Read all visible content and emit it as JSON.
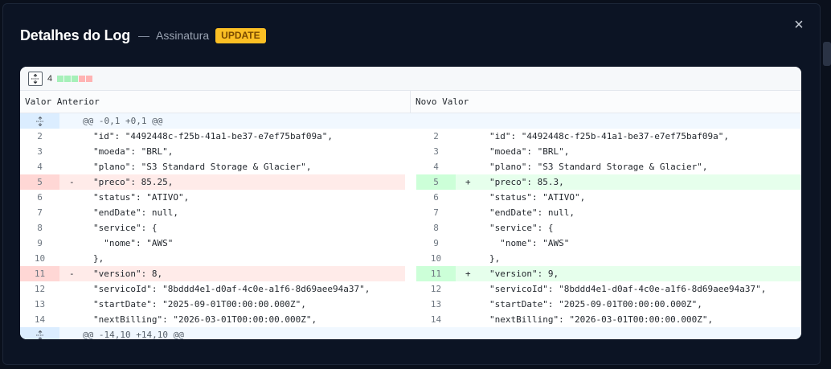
{
  "modal": {
    "title": "Detalhes do Log",
    "separator": "—",
    "subtitle": "Assinatura",
    "badge": "UPDATE",
    "close_icon": "×"
  },
  "toolbar": {
    "change_count": "4",
    "change_blocks": [
      "#a6f0b9",
      "#a6f0b9",
      "#a6f0b9",
      "#ffb3b3",
      "#ffb3b3"
    ]
  },
  "columns": {
    "left": "Valor Anterior",
    "right": "Novo Valor"
  },
  "hunks": {
    "top": "@@ -0,1 +0,1 @@",
    "bottom": "@@ -14,10 +14,10 @@"
  },
  "diff_rows": [
    {
      "left_ln": "2",
      "left": "\"id\": \"4492448c-f25b-41a1-be37-e7ef75baf09a\",",
      "right_ln": "2",
      "right": "\"id\": \"4492448c-f25b-41a1-be37-e7ef75baf09a\",",
      "type": "same"
    },
    {
      "left_ln": "3",
      "left": "\"moeda\": \"BRL\",",
      "right_ln": "3",
      "right": "\"moeda\": \"BRL\",",
      "type": "same"
    },
    {
      "left_ln": "4",
      "left": "\"plano\": \"S3 Standard Storage & Glacier\",",
      "right_ln": "4",
      "right": "\"plano\": \"S3 Standard Storage & Glacier\",",
      "type": "same"
    },
    {
      "left_ln": "5",
      "left_sign": "-",
      "left": "\"preco\": 85.25,",
      "right_ln": "5",
      "right_sign": "+",
      "right": "\"preco\": 85.3,",
      "type": "changed"
    },
    {
      "left_ln": "6",
      "left": "\"status\": \"ATIVO\",",
      "right_ln": "6",
      "right": "\"status\": \"ATIVO\",",
      "type": "same"
    },
    {
      "left_ln": "7",
      "left": "\"endDate\": null,",
      "right_ln": "7",
      "right": "\"endDate\": null,",
      "type": "same"
    },
    {
      "left_ln": "8",
      "left": "\"service\": {",
      "right_ln": "8",
      "right": "\"service\": {",
      "type": "same"
    },
    {
      "left_ln": "9",
      "left": "  \"nome\": \"AWS\"",
      "right_ln": "9",
      "right": "  \"nome\": \"AWS\"",
      "type": "same"
    },
    {
      "left_ln": "10",
      "left": "},",
      "right_ln": "10",
      "right": "},",
      "type": "same"
    },
    {
      "left_ln": "11",
      "left_sign": "-",
      "left": "\"version\": 8,",
      "right_ln": "11",
      "right_sign": "+",
      "right": "\"version\": 9,",
      "type": "changed"
    },
    {
      "left_ln": "12",
      "left": "\"servicoId\": \"8bddd4e1-d0af-4c0e-a1f6-8d69aee94a37\",",
      "right_ln": "12",
      "right": "\"servicoId\": \"8bddd4e1-d0af-4c0e-a1f6-8d69aee94a37\",",
      "type": "same"
    },
    {
      "left_ln": "13",
      "left": "\"startDate\": \"2025-09-01T00:00:00.000Z\",",
      "right_ln": "13",
      "right": "\"startDate\": \"2025-09-01T00:00:00.000Z\",",
      "type": "same"
    },
    {
      "left_ln": "14",
      "left": "\"nextBilling\": \"2026-03-01T00:00:00.000Z\",",
      "right_ln": "14",
      "right": "\"nextBilling\": \"2026-03-01T00:00:00.000Z\",",
      "type": "same"
    }
  ],
  "icons": {
    "expand": "expand-all-icon",
    "hunk": "unfold-icon",
    "close": "close-icon"
  }
}
